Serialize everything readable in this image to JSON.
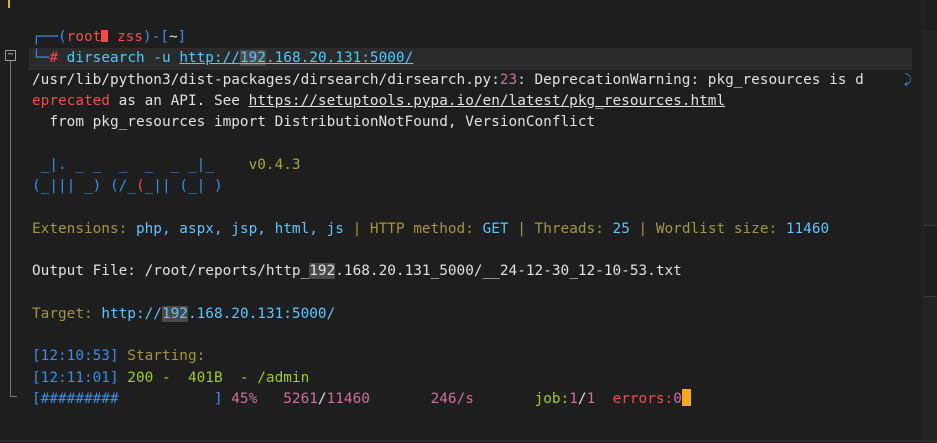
{
  "prompt": {
    "root": "root",
    "host": "zss",
    "dir": "~",
    "symbol": "#",
    "command": "dirsearch -u ",
    "url_prefix": "http://",
    "url_hl": "192",
    "url_rest": ".168.20.131:5000/"
  },
  "warning": {
    "line1_path": "/usr/lib/python3/dist-packages/dirsearch/dirsearch.py",
    "line1_colon": ":",
    "line1_num": "23",
    "line1_msg": ": DeprecationWarning: pkg_resources is d",
    "line2_start": "eprecated",
    "line2_mid": " as an API. See ",
    "line2_url": "https://setuptools.pypa.io/en/latest/pkg_resources.html",
    "line3": "  from pkg_resources import DistributionNotFound, VersionConflict"
  },
  "banner": {
    "row1": " _|. _ _  _  _  _ _|_",
    "version": "v0.4.3",
    "row2a": "(_||| _) (/_",
    "row2b": "(",
    "row2c": "_|| (_| )"
  },
  "config": {
    "ext_label": "Extensions: ",
    "ext_value": "php, aspx, jsp, html, js",
    "sep": " | ",
    "method_label": "HTTP method: ",
    "method_value": "GET",
    "threads_label": "Threads: ",
    "threads_value": "25",
    "wordlist_label": "Wordlist size: ",
    "wordlist_value": "11460"
  },
  "output": {
    "label": "Output File: ",
    "path_a": "/root/reports/http_",
    "path_hl": "192",
    "path_b": ".168.20.131_5000/__24-12-30_12-10-53.txt"
  },
  "target": {
    "label": "Target: ",
    "url_a": "http://",
    "url_hl": "192",
    "url_b": ".168.20.131:5000/"
  },
  "log": {
    "t1": "[12:10:53]",
    "t1_msg": " Starting:",
    "t2": "[12:11:01]",
    "t2_status": " 200 -  401B  - ",
    "t2_path": "/admin"
  },
  "progress": {
    "bar": "[#########           ]",
    "percent": " 45%",
    "done": "5261",
    "slash": "/",
    "total": "11460",
    "rate": "246/s",
    "job_label": "job:",
    "job_cur": "1",
    "job_slash": "/",
    "job_total": "1",
    "errors_label": "errors:",
    "errors_value": "0",
    "fraction": 0.45
  }
}
